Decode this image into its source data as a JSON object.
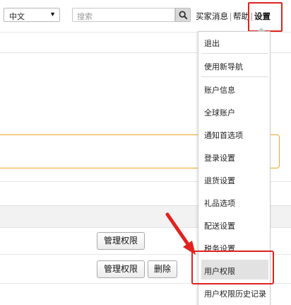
{
  "header": {
    "language": "中文",
    "search_placeholder": "搜索",
    "links": {
      "messages": "买家消息",
      "sep": "|",
      "help": "帮助",
      "settings": "设置"
    }
  },
  "content": {
    "manage_permissions": "管理权限",
    "delete": "删除"
  },
  "menu": {
    "items": [
      "退出",
      "使用新导航",
      "账户信息",
      "全球账户",
      "通知首选项",
      "登录设置",
      "退货设置",
      "礼品选项",
      "配送设置",
      "税务设置",
      "用户权限",
      "用户权限历史记录"
    ],
    "active_index": 10
  },
  "colors": {
    "highlight": "#e0231f",
    "alert_border": "#f0a623"
  },
  "icons": {
    "search": "search-icon",
    "dropdown": "caret-down-icon"
  }
}
